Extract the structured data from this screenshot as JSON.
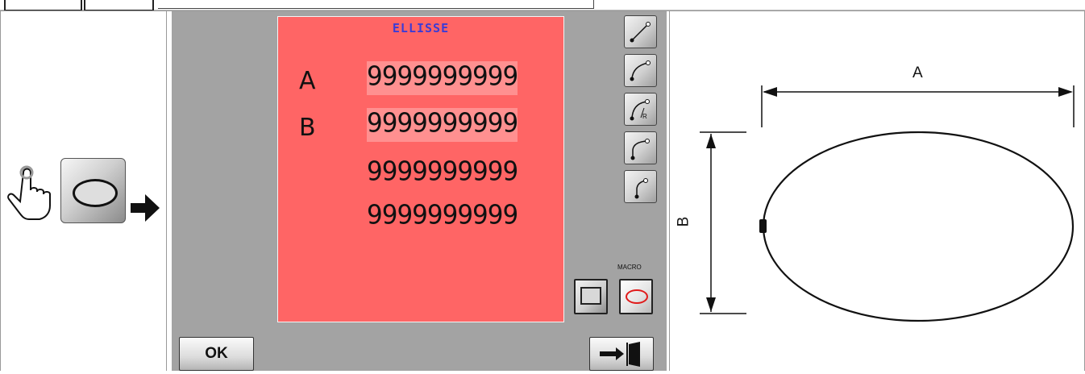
{
  "panel": {
    "title": "ELLISSE",
    "fields": [
      {
        "label": "A",
        "value": "9999999999"
      },
      {
        "label": "B",
        "value": "9999999999"
      },
      {
        "label": "",
        "value": "9999999999"
      },
      {
        "label": "",
        "value": "9999999999"
      }
    ],
    "macro_label": "MACRO",
    "ok_label": "OK",
    "colors": {
      "panel_bg": "#a3a3a3",
      "form_bg": "#ff6565",
      "title": "#3b3bd6"
    }
  },
  "tools": [
    "line-icon",
    "arc-icon",
    "radius-arc-icon",
    "tangent-line-arc-icon",
    "tangent-arc-icon"
  ],
  "icons": {
    "left": [
      "pointing-hand-icon",
      "ellipse-button-icon",
      "right-arrow-icon"
    ],
    "exit": "exit-door-icon",
    "macro": [
      "rectangle-macro-icon",
      "ellipse-macro-icon"
    ]
  },
  "diagram": {
    "dim_a": "A",
    "dim_b": "B"
  }
}
